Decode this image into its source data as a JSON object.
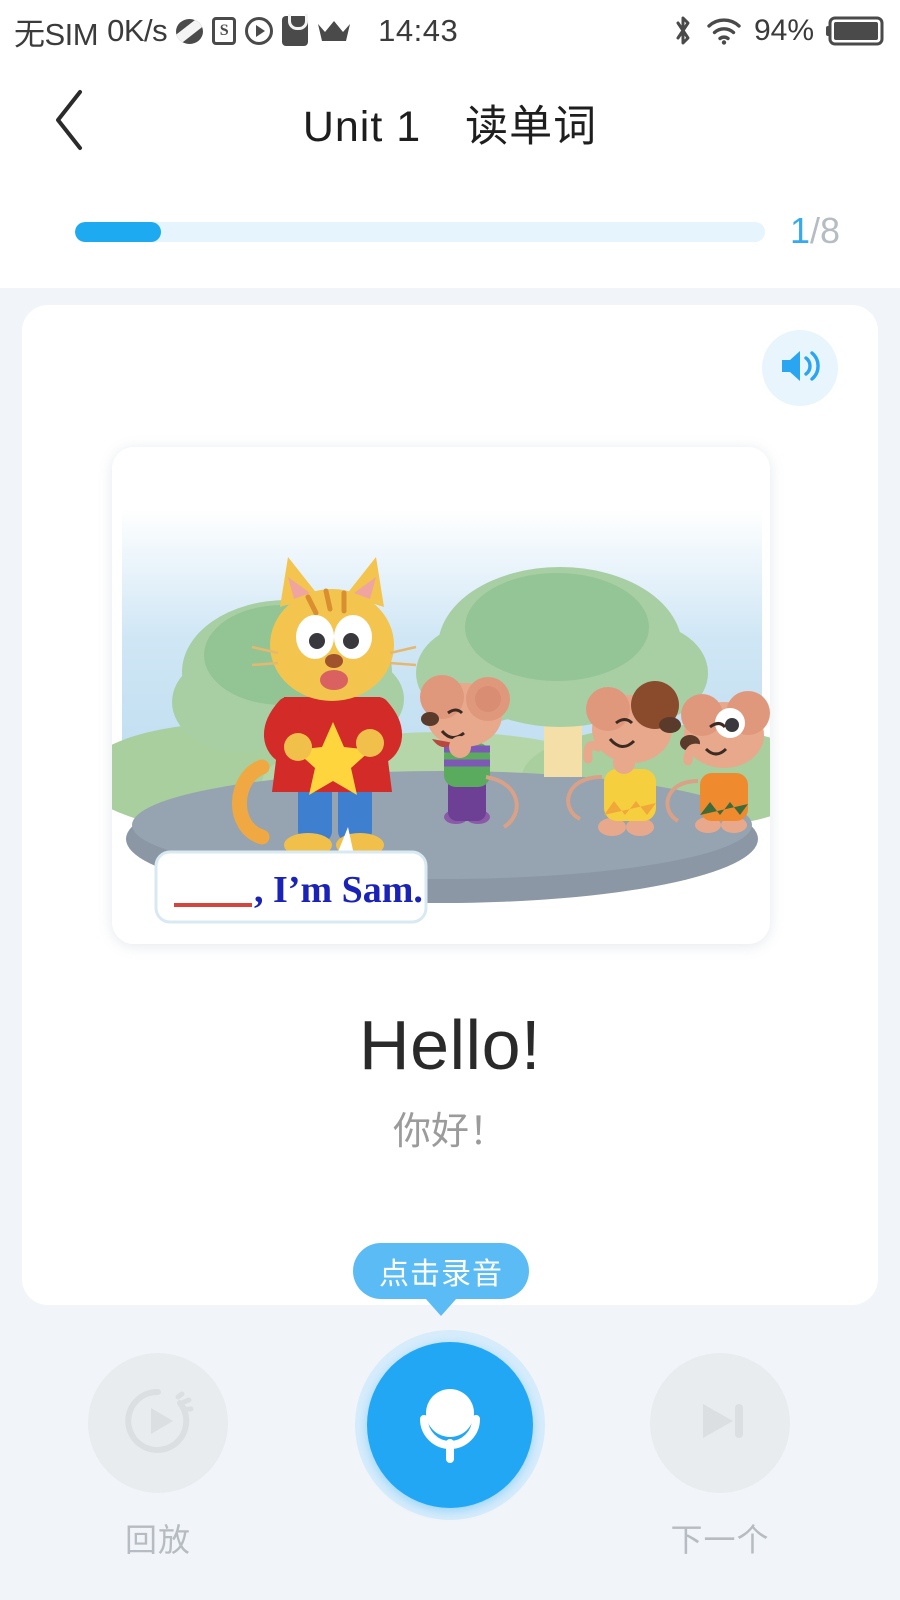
{
  "statusbar": {
    "carrier": "无SIM",
    "network_speed": "0K/s",
    "time": "14:43",
    "battery_percent": "94%",
    "icons": [
      "ball-icon",
      "s-app-icon",
      "play-app-icon",
      "bag-app-icon",
      "crown-icon",
      "bluetooth-icon",
      "wifi-icon",
      "battery-icon"
    ]
  },
  "header": {
    "back_icon": "chevron-left-icon",
    "title": "Unit 1　读单词",
    "progress": {
      "current": "1",
      "separator": "/8",
      "percent": 12.5
    }
  },
  "card": {
    "sound_icon": "speaker-icon",
    "illustration": {
      "speech_blank": "______",
      "speech_text": ", I'm Sam.",
      "alt": "cartoon cat greeting three mice in a park"
    },
    "word_en": "Hello!",
    "word_zh": "你好！"
  },
  "tooltip": {
    "label": "点击录音"
  },
  "controls": {
    "playback": {
      "label": "回放",
      "icon": "replay-play-icon",
      "enabled": false
    },
    "record": {
      "icon": "microphone-icon",
      "enabled": true
    },
    "next": {
      "label": "下一个",
      "icon": "skip-next-icon",
      "enabled": false
    }
  },
  "colors": {
    "accent": "#22a7f5",
    "progress_fill": "#1eaaf1",
    "tooltip_bg": "#5bbcf5",
    "page_bg": "#f1f5f9",
    "disabled": "#e8ecef"
  }
}
